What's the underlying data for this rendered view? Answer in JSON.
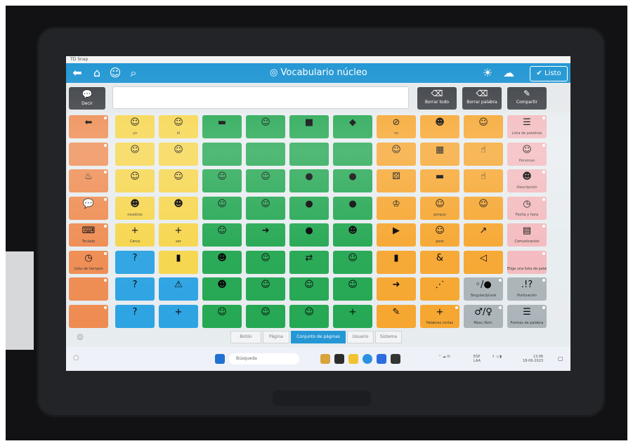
{
  "window": {
    "app_name": "TD Snap"
  },
  "topbar": {
    "title": "Vocabulario núcleo",
    "done_label": "Listo",
    "back_icon": "back-arrow-icon",
    "home_icon": "home-icon",
    "search_icon": "search-icon"
  },
  "message": {
    "speak_label": "Decir",
    "clear_all_label": "Borrar todo",
    "delete_word_label": "Borrar palabra",
    "share_label": "Compartir"
  },
  "colors": {
    "topbar": "#2196d3",
    "yellow": "#f6d54a",
    "green": "#21a650",
    "orange": "#f6a52d",
    "blue": "#2aa2e2",
    "pink": "#f3b9bd",
    "nav_orange": "#ee8a4f",
    "grey": "#a9b3b8"
  },
  "grid": {
    "columns": [
      [
        {
          "label": "",
          "color": "nav_orange",
          "icon": "back-arrow-icon"
        },
        {
          "label": "",
          "color": "nav_orange",
          "icon": "blank"
        },
        {
          "label": "",
          "color": "nav_orange",
          "icon": "fire-icon"
        },
        {
          "label": "",
          "color": "nav_orange",
          "icon": "speech-icon"
        },
        {
          "label": "Teclado",
          "color": "nav_orange",
          "icon": "keyboard-icon"
        },
        {
          "label": "Lista de tiempos",
          "color": "nav_orange",
          "icon": "clock-icon"
        },
        {
          "label": "",
          "color": "nav_orange",
          "icon": "blank"
        },
        {
          "label": "",
          "color": "nav_orange",
          "icon": "blank"
        }
      ],
      [
        {
          "label": "yo",
          "color": "yellow",
          "icon": "person-icon"
        },
        {
          "label": "",
          "color": "yellow",
          "icon": "person-icon"
        },
        {
          "label": "",
          "color": "yellow",
          "icon": "person-icon"
        },
        {
          "label": "nosotros",
          "color": "yellow",
          "icon": "people-icon"
        },
        {
          "label": "Cerca",
          "color": "yellow",
          "icon": "plus-icon"
        },
        {
          "label": "",
          "color": "blue",
          "icon": "question-box-icon"
        },
        {
          "label": "",
          "color": "blue",
          "icon": "question-icon"
        },
        {
          "label": "",
          "color": "blue",
          "icon": "question-icon"
        }
      ],
      [
        {
          "label": "él",
          "color": "yellow",
          "icon": "person-icon"
        },
        {
          "label": "",
          "color": "yellow",
          "icon": "person-icon"
        },
        {
          "label": "",
          "color": "yellow",
          "icon": "person-icon"
        },
        {
          "label": "",
          "color": "yellow",
          "icon": "people-icon"
        },
        {
          "label": "ser",
          "color": "yellow",
          "icon": "plus-icon"
        },
        {
          "label": "",
          "color": "yellow",
          "icon": "box-icon"
        },
        {
          "label": "",
          "color": "blue",
          "icon": "warning-icon"
        },
        {
          "label": "",
          "color": "blue",
          "icon": "plus-icon"
        }
      ],
      [
        {
          "label": "",
          "color": "green",
          "icon": "dash-icon"
        },
        {
          "label": "",
          "color": "green",
          "icon": "blank"
        },
        {
          "label": "",
          "color": "green",
          "icon": "person-icon"
        },
        {
          "label": "",
          "color": "green",
          "icon": "person-icon"
        },
        {
          "label": "",
          "color": "green",
          "icon": "person-icon"
        },
        {
          "label": "",
          "color": "green",
          "icon": "people-icon"
        },
        {
          "label": "",
          "color": "green",
          "icon": "people-icon"
        },
        {
          "label": "",
          "color": "green",
          "icon": "person-icon"
        }
      ],
      [
        {
          "label": "",
          "color": "green",
          "icon": "person-icon"
        },
        {
          "label": "",
          "color": "green",
          "icon": "blank"
        },
        {
          "label": "",
          "color": "green",
          "icon": "person-icon"
        },
        {
          "label": "",
          "color": "green",
          "icon": "person-icon"
        },
        {
          "label": "",
          "color": "green",
          "icon": "arrow-icon"
        },
        {
          "label": "",
          "color": "green",
          "icon": "person-icon"
        },
        {
          "label": "",
          "color": "green",
          "icon": "person-icon"
        },
        {
          "label": "",
          "color": "green",
          "icon": "person-icon"
        }
      ],
      [
        {
          "label": "",
          "color": "green",
          "icon": "square-icon"
        },
        {
          "label": "",
          "color": "green",
          "icon": "blank"
        },
        {
          "label": "",
          "color": "green",
          "icon": "head-icon"
        },
        {
          "label": "",
          "color": "green",
          "icon": "head-icon"
        },
        {
          "label": "",
          "color": "green",
          "icon": "head-icon"
        },
        {
          "label": "",
          "color": "green",
          "icon": "arrows-icon"
        },
        {
          "label": "",
          "color": "green",
          "icon": "person-icon"
        },
        {
          "label": "",
          "color": "green",
          "icon": "person-icon"
        }
      ],
      [
        {
          "label": "",
          "color": "green",
          "icon": "object-icon"
        },
        {
          "label": "",
          "color": "green",
          "icon": "blank"
        },
        {
          "label": "",
          "color": "green",
          "icon": "head-icon"
        },
        {
          "label": "",
          "color": "green",
          "icon": "head-icon"
        },
        {
          "label": "",
          "color": "green",
          "icon": "people-icon"
        },
        {
          "label": "",
          "color": "green",
          "icon": "person-icon"
        },
        {
          "label": "",
          "color": "green",
          "icon": "person-icon"
        },
        {
          "label": "",
          "color": "green",
          "icon": "plus-icon"
        }
      ],
      [
        {
          "label": "no",
          "color": "orange",
          "icon": "no-icon"
        },
        {
          "label": "",
          "color": "orange",
          "icon": "person-icon"
        },
        {
          "label": "",
          "color": "orange",
          "icon": "dice-icon"
        },
        {
          "label": "",
          "color": "orange",
          "icon": "crown-icon"
        },
        {
          "label": "",
          "color": "orange",
          "icon": "play-icon"
        },
        {
          "label": "",
          "color": "orange",
          "icon": "box-icon"
        },
        {
          "label": "",
          "color": "orange",
          "icon": "arrow-icon"
        },
        {
          "label": "",
          "color": "orange",
          "icon": "pencil-icon"
        }
      ],
      [
        {
          "label": "",
          "color": "orange",
          "icon": "people-icon"
        },
        {
          "label": "",
          "color": "orange",
          "icon": "grid-icon"
        },
        {
          "label": "",
          "color": "orange",
          "icon": "dash-icon"
        },
        {
          "label": "porque",
          "color": "orange",
          "icon": "person-icon"
        },
        {
          "label": "pero",
          "color": "orange",
          "icon": "person-icon"
        },
        {
          "label": "",
          "color": "orange",
          "icon": "ampersand-icon"
        },
        {
          "label": "",
          "color": "orange",
          "icon": "dots-icon"
        },
        {
          "label": "Palabras cortas",
          "color": "orange",
          "icon": "plus-icon"
        }
      ],
      [
        {
          "label": "",
          "color": "orange",
          "icon": "face-icon"
        },
        {
          "label": "",
          "color": "orange",
          "icon": "finger-icon"
        },
        {
          "label": "",
          "color": "orange",
          "icon": "finger-icon"
        },
        {
          "label": "",
          "color": "orange",
          "icon": "person-icon"
        },
        {
          "label": "",
          "color": "orange",
          "icon": "pointer-icon"
        },
        {
          "label": "",
          "color": "orange",
          "icon": "triangle-icon"
        },
        {
          "label": "Singular/plural",
          "color": "grey",
          "icon": "plural-icon"
        },
        {
          "label": "Masc./fem.",
          "color": "grey",
          "icon": "gender-icon"
        }
      ],
      [
        {
          "label": "Lista de palabras",
          "color": "pink",
          "icon": "list-icon"
        },
        {
          "label": "Personas",
          "color": "pink",
          "icon": "person-icon"
        },
        {
          "label": "Descripción",
          "color": "pink",
          "icon": "people-icon"
        },
        {
          "label": "Fecha y hora",
          "color": "pink",
          "icon": "clock-icon"
        },
        {
          "label": "Comunicación",
          "color": "pink",
          "icon": "chart-icon"
        },
        {
          "label": "Elige una lista de palabras",
          "color": "pink",
          "icon": "blank"
        },
        {
          "label": "Puntuación",
          "color": "grey",
          "icon": "punctuation-icon"
        },
        {
          "label": "Formas de palabra",
          "color": "grey",
          "icon": "list-icon"
        }
      ]
    ]
  },
  "tabs": [
    {
      "label": "Botón",
      "active": false
    },
    {
      "label": "Página",
      "active": false
    },
    {
      "label": "Conjunto de páginas",
      "active": true
    },
    {
      "label": "Usuario",
      "active": false
    },
    {
      "label": "Sistema",
      "active": false
    }
  ],
  "taskbar": {
    "search_placeholder": "Búsqueda",
    "lang": "ESP",
    "lang2": "LAA",
    "time": "13:06",
    "date": "18-06-2023"
  }
}
